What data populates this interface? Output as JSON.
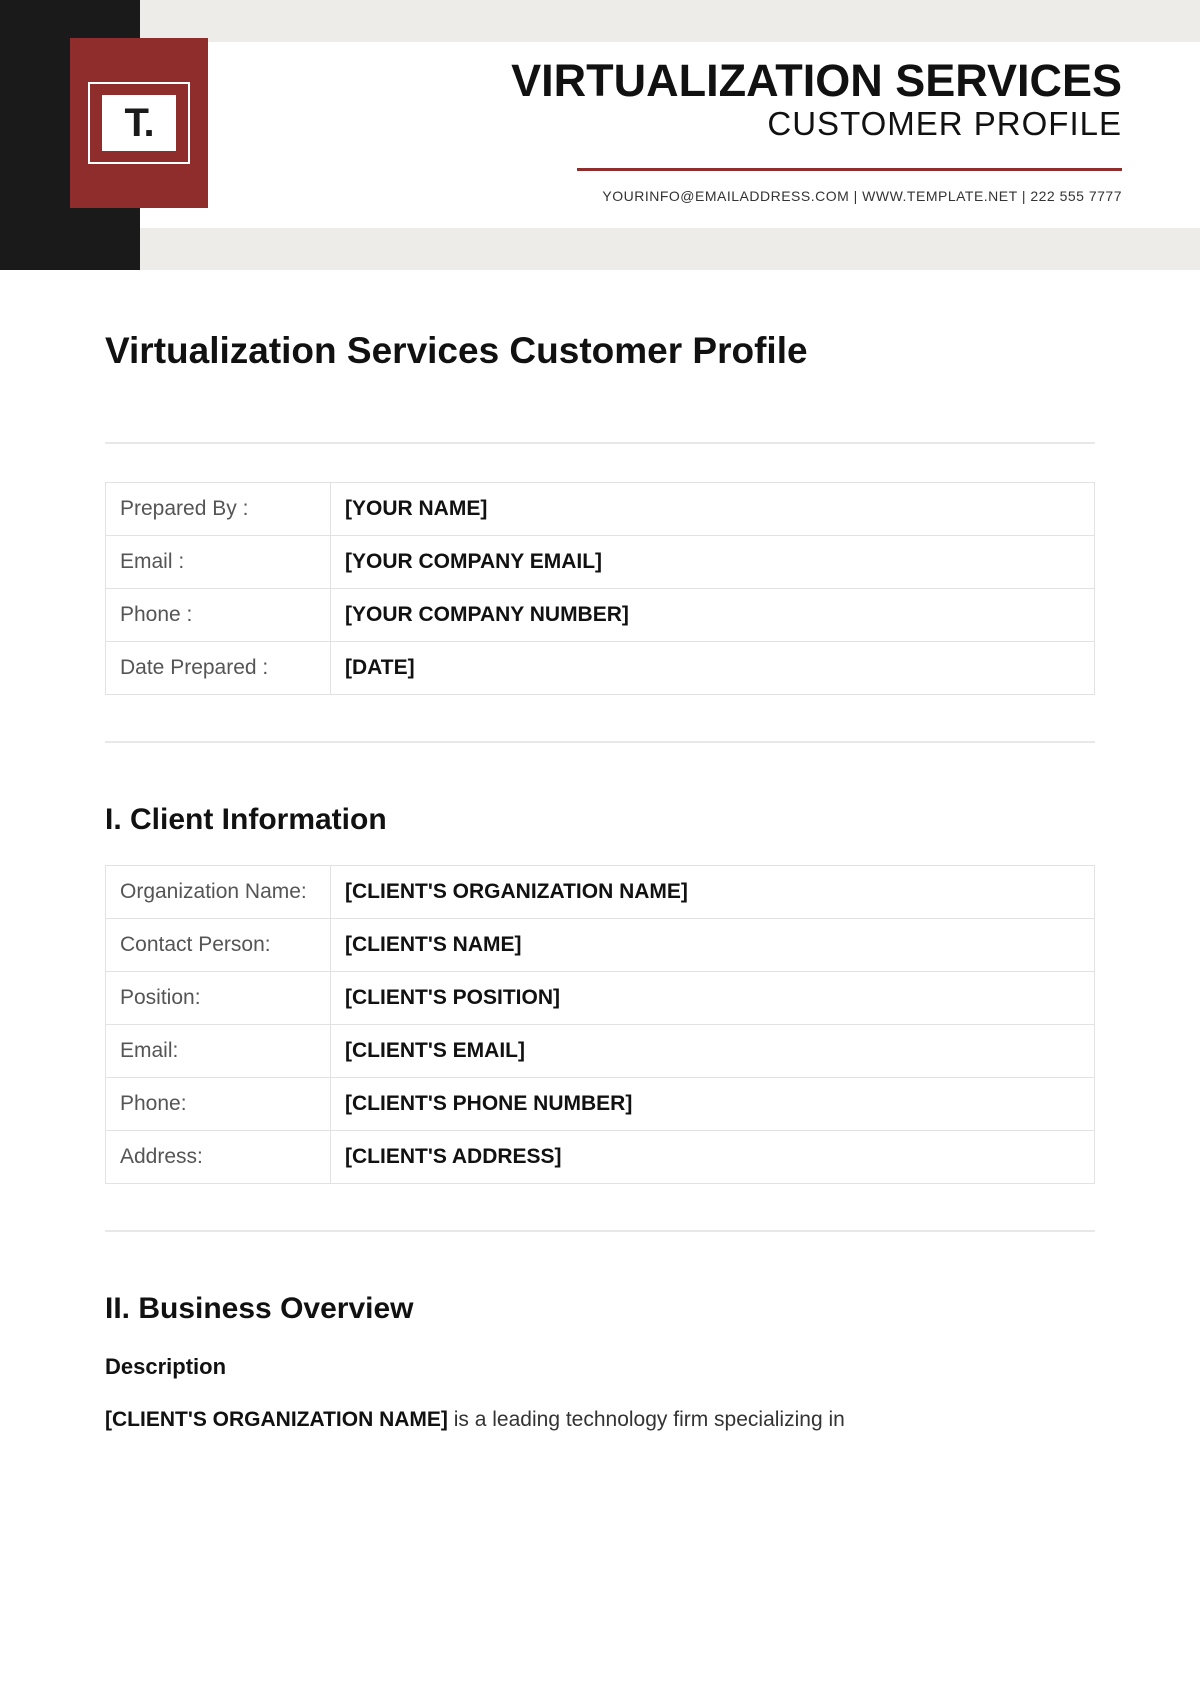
{
  "logo_text": "T.",
  "header": {
    "line1": "VIRTUALIZATION SERVICES",
    "line2": "CUSTOMER PROFILE",
    "contact": "YOURINFO@EMAILADDRESS.COM | WWW.TEMPLATE.NET | 222 555 7777"
  },
  "doc_title": "Virtualization Services Customer Profile",
  "prep_table": [
    {
      "label": "Prepared By :",
      "value": "[YOUR NAME]"
    },
    {
      "label": "Email :",
      "value": "[YOUR COMPANY EMAIL]"
    },
    {
      "label": "Phone :",
      "value": "[YOUR COMPANY NUMBER]"
    },
    {
      "label": "Date Prepared :",
      "value": "[DATE]"
    }
  ],
  "section1_heading": "I. Client Information",
  "client_table": [
    {
      "label": "Organization Name:",
      "value": "[CLIENT'S ORGANIZATION NAME]"
    },
    {
      "label": "Contact Person:",
      "value": "[CLIENT'S NAME]"
    },
    {
      "label": "Position:",
      "value": "[CLIENT'S POSITION]"
    },
    {
      "label": "Email:",
      "value": "[CLIENT'S EMAIL]"
    },
    {
      "label": "Phone:",
      "value": "[CLIENT'S PHONE NUMBER]"
    },
    {
      "label": "Address:",
      "value": "[CLIENT'S ADDRESS]"
    }
  ],
  "section2_heading": "II. Business Overview",
  "section2_subhead": "Description",
  "section2_body_bold": "[CLIENT'S ORGANIZATION NAME]",
  "section2_body_rest": " is a leading technology firm specializing in"
}
